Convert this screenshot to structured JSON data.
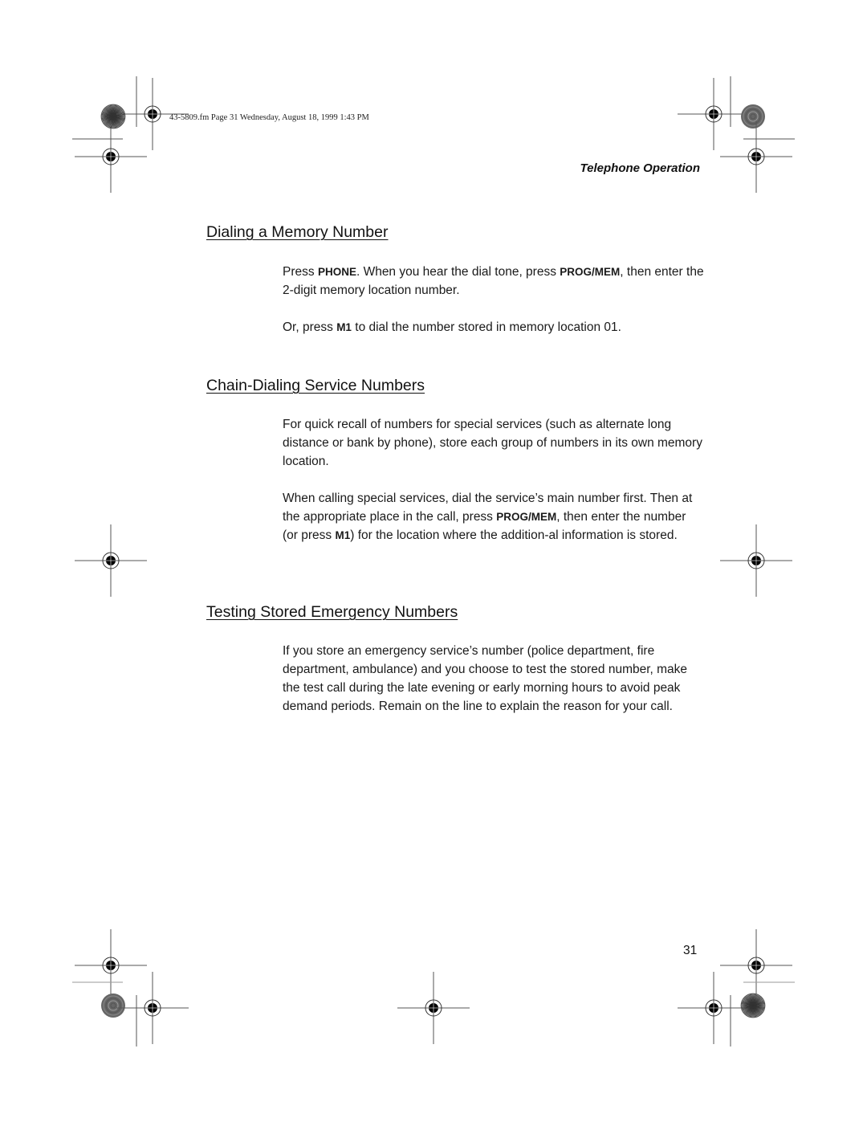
{
  "slug_line": "43-5809.fm  Page 31  Wednesday, August 18, 1999  1:43 PM",
  "running_head": "Telephone Operation",
  "sections": [
    {
      "title": "Dialing a Memory Number",
      "paragraphs": [
        [
          {
            "t": "Press "
          },
          {
            "t": "PHONE",
            "b": true
          },
          {
            "t": ". When you hear the dial tone, press "
          },
          {
            "t": "PROG/MEM",
            "b": true
          },
          {
            "t": ", then enter the 2-digit memory location number."
          }
        ],
        [
          {
            "t": "Or, press "
          },
          {
            "t": "M1",
            "b": true
          },
          {
            "t": " to dial the number stored in memory location 01."
          }
        ]
      ]
    },
    {
      "title": "Chain-Dialing Service Numbers",
      "paragraphs": [
        [
          {
            "t": "For quick recall of numbers for special services (such as alternate long distance or bank by phone), store each group of numbers in its own memory location."
          }
        ],
        [
          {
            "t": "When calling special services, dial the service’s main number first. Then at the appropriate place in the call, press "
          },
          {
            "t": "PROG/MEM",
            "b": true
          },
          {
            "t": ", then enter the number (or press "
          },
          {
            "t": "M1",
            "b": true
          },
          {
            "t": ") for the location where the addition-al information is stored."
          }
        ]
      ]
    },
    {
      "title": "Testing Stored Emergency Numbers",
      "paragraphs": [
        [
          {
            "t": "If you store an emergency service’s number (police department, fire department, ambulance) and you choose to test the stored number, make the test call during the late evening or early morning hours to avoid peak demand periods. Remain on the line to explain the reason for your call."
          }
        ]
      ]
    }
  ],
  "page_number": "31",
  "print_marks": {
    "registration_marks": [
      "registration-crosshair-icon"
    ],
    "color_wheels": [
      "starburst-target-icon",
      "concentric-target-icon"
    ],
    "ink_color": "#555555"
  }
}
